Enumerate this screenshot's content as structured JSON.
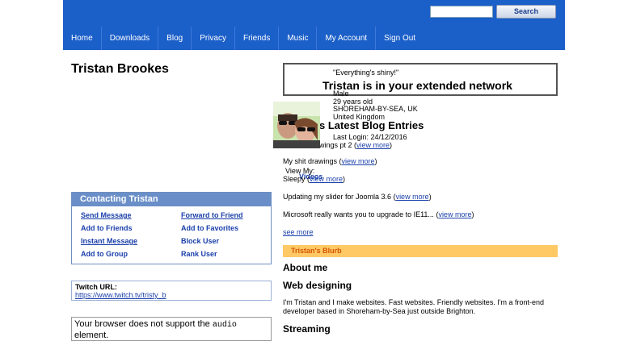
{
  "header": {
    "search_placeholder": "",
    "search_button": "Search",
    "nav": [
      "Home",
      "Downloads",
      "Blog",
      "Privacy",
      "Friends",
      "Music",
      "My Account",
      "Sign Out"
    ]
  },
  "profile": {
    "name": "Tristan Brookes",
    "mood": "\"Everything's shiny!\"",
    "network": "Tristan is in your extended network",
    "gender": "Male",
    "age": "29 years old",
    "city": "SHOREHAM-BY-SEA, UK",
    "country": "United Kingdom",
    "last_login": "Last Login: 24/12/2016",
    "view_my": "View My:",
    "videos": "Videos"
  },
  "contact": {
    "title": "Contacting Tristan",
    "links": [
      "Send Message",
      "Forward to Friend",
      "Add to Friends",
      "Add to Favorites",
      "Instant Message",
      "Block User",
      "Add to Group",
      "Rank User"
    ]
  },
  "twitch": {
    "label": "Twitch URL:",
    "url": "https://www.twitch.tv/tristy_b"
  },
  "audio": {
    "before": "Your browser does not support the ",
    "code": "audio",
    "after": "element."
  },
  "blog": {
    "heading": "s Latest Blog Entries",
    "view_more": "view more",
    "entries": [
      {
        "title": "wings pt 2 "
      },
      {
        "title": "My shit drawings "
      },
      {
        "title": "Sleepy "
      },
      {
        "title": "Updating my slider for Joomla 3.6 "
      },
      {
        "title": "Microsoft really wants you to upgrade to IE11... "
      }
    ],
    "see_more": "see more"
  },
  "blurb": {
    "title": "Tristan's Blurb",
    "about": "About me",
    "web": "Web designing",
    "text": "I'm Tristan and I make websites. Fast websites. Friendly websites. I'm a front-end developer based in Shoreham-by-Sea just outside Brighton.",
    "streaming": "Streaming"
  },
  "colors": {
    "header": "#1b5fc9",
    "contact_title": "#6a8fc8",
    "link": "#1a3faa",
    "blurb_bar": "#ffc966",
    "blurb_text": "#d45500"
  }
}
